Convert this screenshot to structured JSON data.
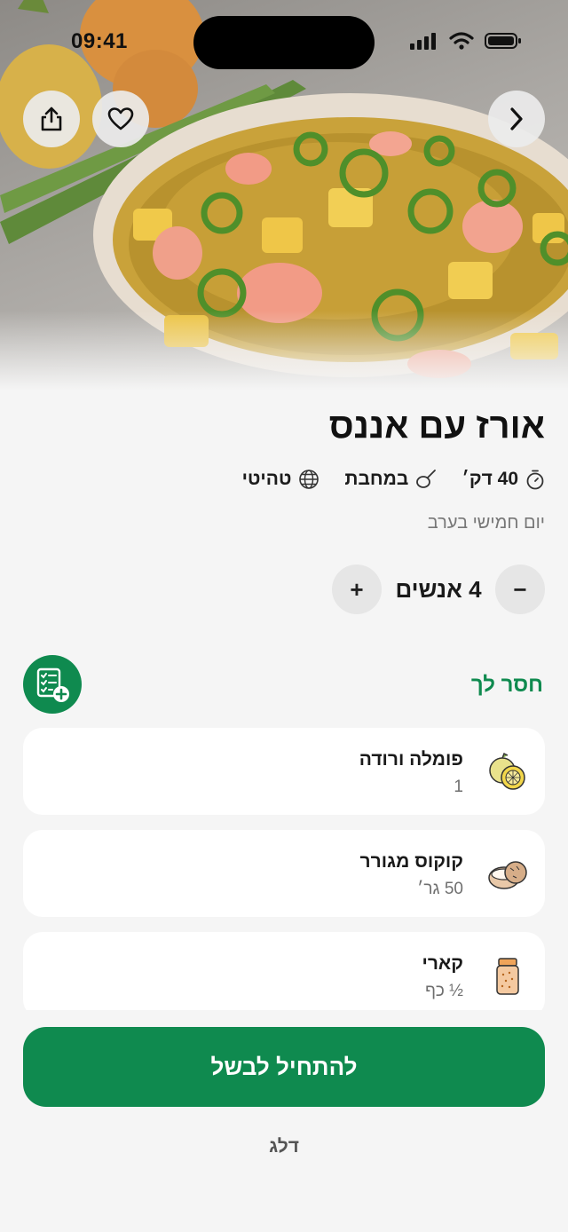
{
  "status_bar": {
    "time": "09:41"
  },
  "recipe": {
    "title": "אורז עם אננס",
    "time": "40 דק׳",
    "cookware": "במחבת",
    "cuisine": "טהיטי",
    "subtitle": "יום חמישי בערב"
  },
  "servings": {
    "label": "4 אנשים",
    "minus": "−",
    "plus": "+"
  },
  "missing": {
    "title": "חסר לך",
    "items": [
      {
        "name": "פומלה ורודה",
        "qty": "1",
        "icon": "pomelo-icon"
      },
      {
        "name": "קוקוס מגורר",
        "qty": "50 גר׳",
        "icon": "coconut-icon"
      },
      {
        "name": "קארי",
        "qty": "½ כף",
        "icon": "curry-jar-icon"
      }
    ]
  },
  "actions": {
    "start": "להתחיל לבשל",
    "skip": "דלג"
  },
  "colors": {
    "accent": "#0f8a4f",
    "background": "#f5f5f5"
  }
}
